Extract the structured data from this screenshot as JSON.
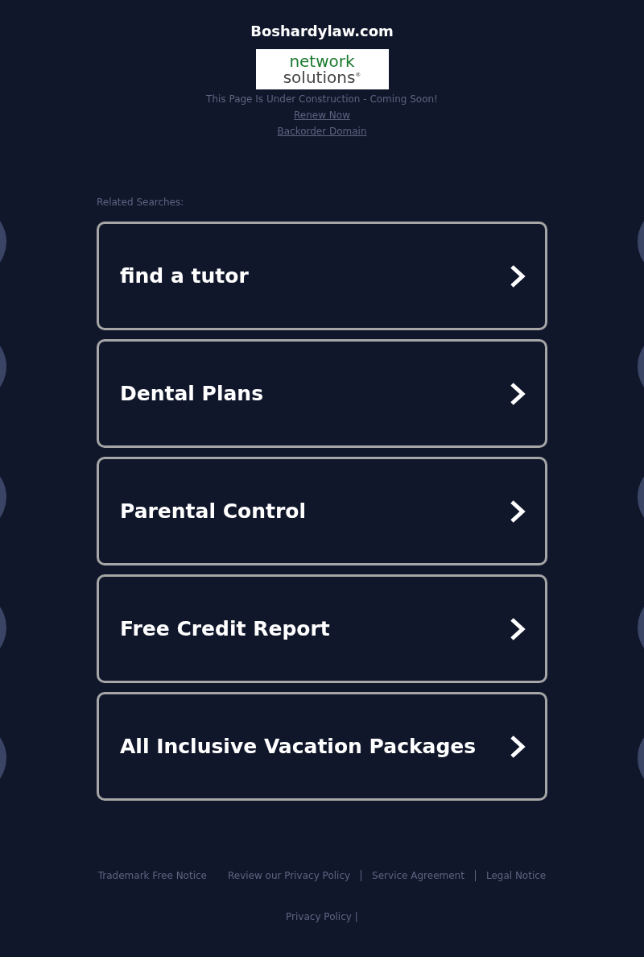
{
  "site_title": "Boshardylaw.com",
  "logo": {
    "line_1": "network",
    "line_2": "solutions",
    "mark": "®"
  },
  "notice": "This Page Is Under Construction - Coming Soon!",
  "links": [
    "Renew Now",
    "Backorder Domain"
  ],
  "related_label": "Related Searches:",
  "searches": [
    "find a tutor",
    "Dental Plans",
    "Parental Control",
    "Free Credit Report",
    "All Inclusive Vacation Packages"
  ],
  "footer_links": [
    "Trademark Free Notice",
    "Review our Privacy Policy",
    "Service Agreement",
    "Legal Notice"
  ],
  "privacy_link": "Privacy Policy",
  "privacy_separator": "|"
}
